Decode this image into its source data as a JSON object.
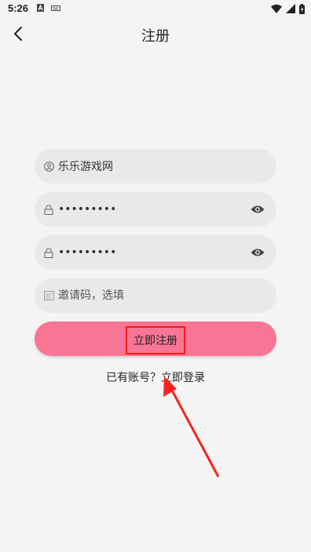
{
  "status_bar": {
    "time": "5:26"
  },
  "app_bar": {
    "title": "注册"
  },
  "form": {
    "username": {
      "value": "乐乐游戏网"
    },
    "password": {
      "value": "•••••••••"
    },
    "confirm_password": {
      "value": "•••••••••"
    },
    "invite_code": {
      "placeholder": "邀请码，选填"
    }
  },
  "register_button": {
    "label": "立即注册"
  },
  "login_prompt": {
    "text": "已有账号？",
    "link": "立即登录"
  },
  "colors": {
    "accent": "#f97595",
    "highlight": "#ff1a1a"
  }
}
